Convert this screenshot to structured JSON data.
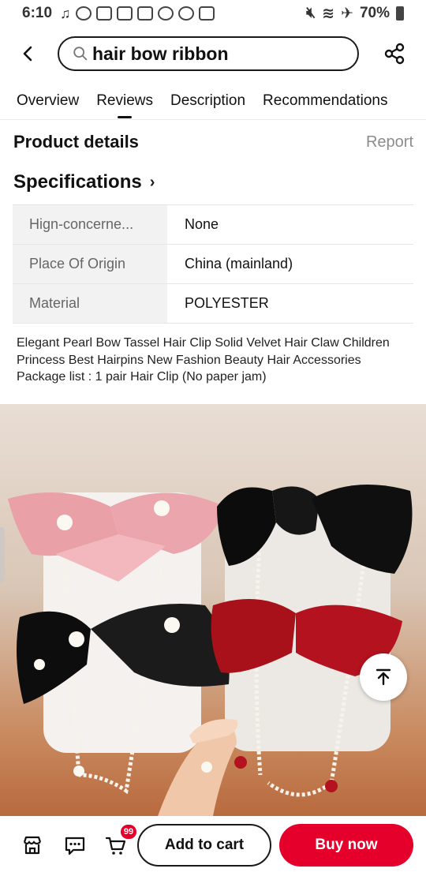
{
  "status_bar": {
    "time": "6:10",
    "battery": "70%"
  },
  "search": {
    "query": "hair bow ribbon"
  },
  "tabs": [
    {
      "label": "Overview"
    },
    {
      "label": "Reviews",
      "active": true
    },
    {
      "label": "Description"
    },
    {
      "label": "Recommendations"
    }
  ],
  "product_details": {
    "title": "Product details",
    "report_label": "Report"
  },
  "specifications": {
    "title": "Specifications",
    "rows": [
      {
        "key": "Hign-concerne...",
        "value": "None"
      },
      {
        "key": "Place Of Origin",
        "value": "China (mainland)"
      },
      {
        "key": "Material",
        "value": "POLYESTER"
      }
    ]
  },
  "description": {
    "line1": "Elegant Pearl Bow Tassel Hair Clip Solid Velvet Hair Claw Children Princess Best Hairpins New Fashion Beauty Hair Accessories",
    "line2": "Package list : 1 pair Hair Clip (No paper jam)"
  },
  "bottom_bar": {
    "cart_count": "99",
    "add_to_cart": "Add to cart",
    "buy_now": "Buy now"
  },
  "colors": {
    "accent": "#e4002b",
    "bow_pink": "#e9a0a6",
    "bow_black": "#111111",
    "bow_red": "#b3121e"
  }
}
